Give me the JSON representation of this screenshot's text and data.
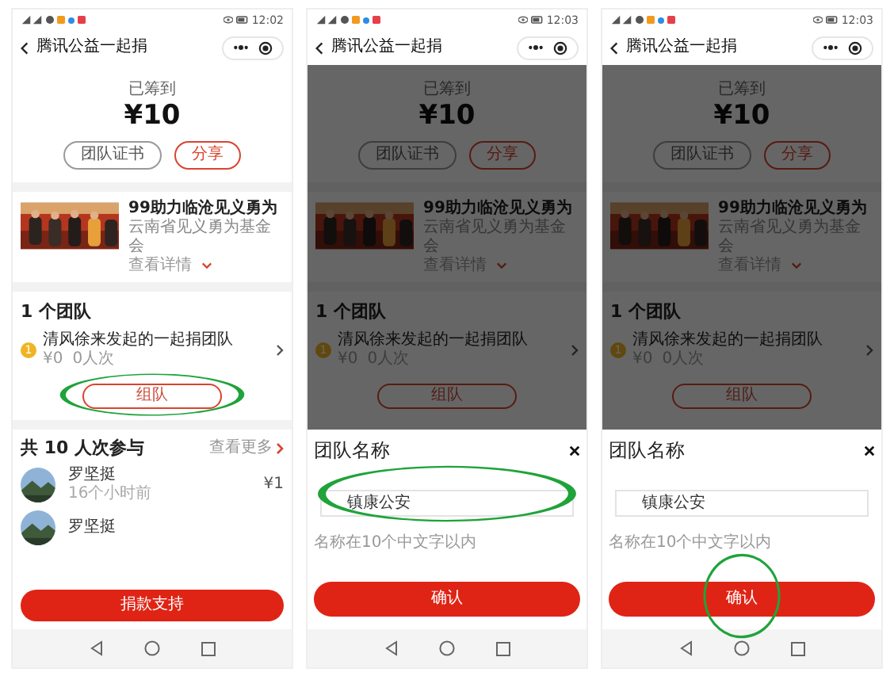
{
  "screens": [
    {
      "kind": "list",
      "status_time": "12:02",
      "title": "腾讯公益一起捐",
      "raised_label": "已筹到",
      "amount": "¥10",
      "buttons": [
        {
          "label": "团队证书",
          "kind": "outline"
        },
        {
          "label": "分享",
          "kind": "accent"
        }
      ],
      "project": {
        "kind": "picture",
        "title": "99助力临沧见义勇为",
        "org": "云南省见义勇为基金会",
        "details": "查看详情"
      },
      "team_heading": "1 个团队",
      "team": {
        "rank": "1",
        "name": "清风徐来发起的一起捐团队",
        "amount": "¥0",
        "count": "0人次",
        "join": "组队",
        "join_circled": true
      },
      "participants": {
        "heading": "共 10 人次参与",
        "more": "查看更多",
        "donors": [
          {
            "name": "罗坚挺",
            "time": "16个小时前",
            "amount": "¥1"
          },
          {
            "name": "罗坚挺"
          }
        ]
      },
      "donate": "捐款支持"
    },
    {
      "kind": "dialog",
      "status_time": "12:03",
      "title": "腾讯公益一起捐",
      "raised_label": "已筹到",
      "amount": "¥10",
      "buttons": [
        {
          "label": "团队证书",
          "kind": "outline"
        },
        {
          "label": "分享",
          "kind": "accent"
        }
      ],
      "project": {
        "kind": "picture",
        "title": "99助力临沧见义勇为",
        "org": "云南省见义勇为基金会",
        "details": "查看详情"
      },
      "team_heading": "1 个团队",
      "team": {
        "rank": "1",
        "name": "清风徐来发起的一起捐团队",
        "amount": "¥0",
        "count": "0人次",
        "join": "组队",
        "join_circled": false
      },
      "dialog": {
        "title": "团队名称",
        "value": "镇康公安",
        "hint": "名称在10个中文字以内",
        "confirm": "确认",
        "field_circled": true,
        "confirm_circled": false
      }
    },
    {
      "kind": "dialog",
      "status_time": "12:03",
      "title": "腾讯公益一起捐",
      "raised_label": "已筹到",
      "amount": "¥10",
      "buttons": [
        {
          "label": "团队证书",
          "kind": "outline"
        },
        {
          "label": "分享",
          "kind": "accent"
        }
      ],
      "project": {
        "kind": "picture",
        "title": "99助力临沧见义勇为",
        "org": "云南省见义勇为基金会",
        "details": "查看详情"
      },
      "team_heading": "1 个团队",
      "team": {
        "rank": "1",
        "name": "清风徐来发起的一起捐团队",
        "amount": "¥0",
        "count": "0人次",
        "join": "组队",
        "join_circled": false
      },
      "dialog": {
        "title": "团队名称",
        "value": "镇康公安",
        "hint": "名称在10个中文字以内",
        "confirm": "确认",
        "field_circled": false,
        "confirm_circled": true
      }
    }
  ]
}
